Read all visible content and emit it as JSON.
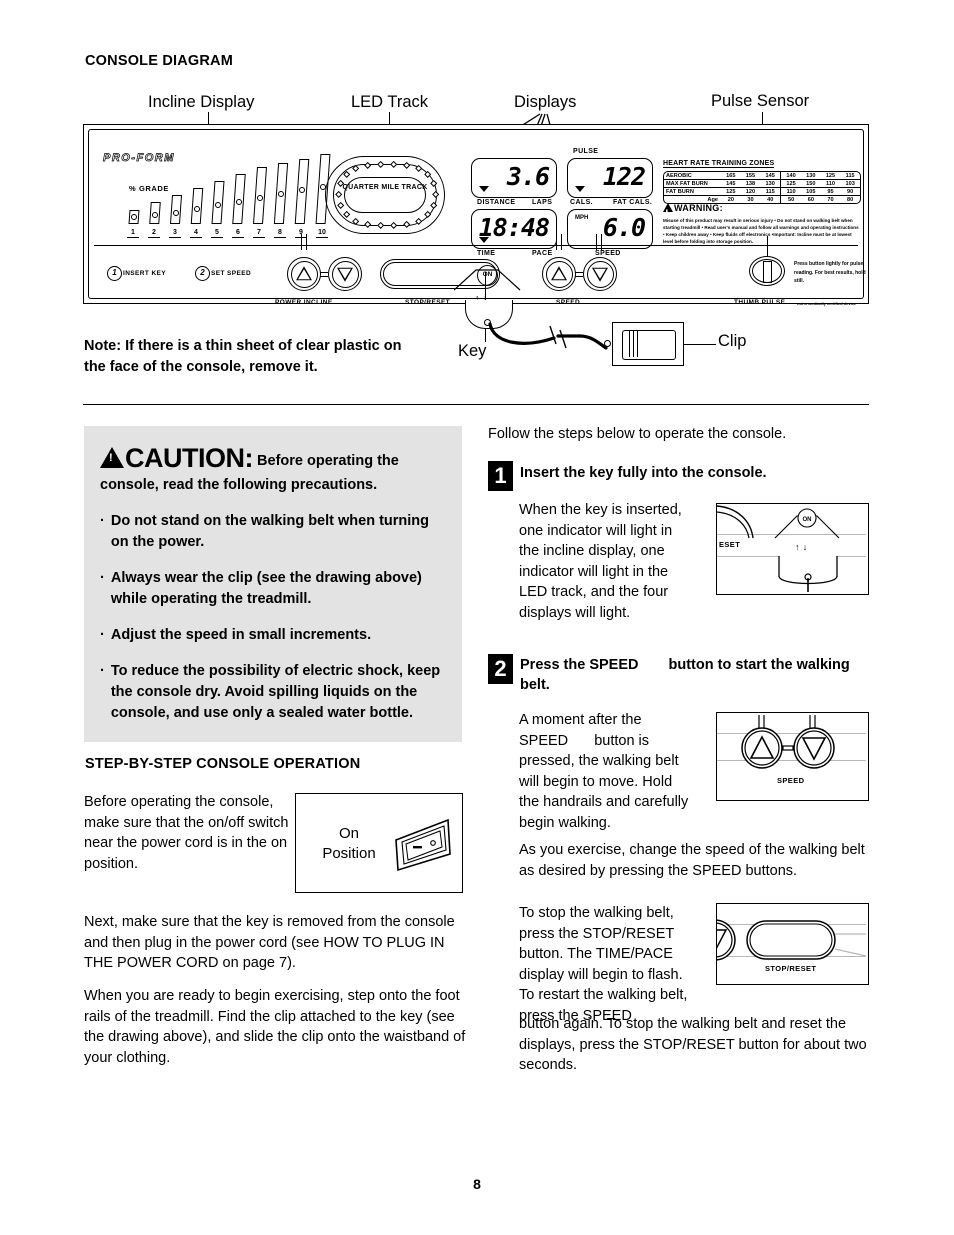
{
  "page": {
    "number": "8",
    "section_titles": {
      "console_diagram": "CONSOLE DIAGRAM",
      "step_by_step": "STEP-BY-STEP CONSOLE OPERATION"
    }
  },
  "callouts": {
    "incline_display": "Incline Display",
    "led_track": "LED Track",
    "displays": "Displays",
    "pulse_sensor": "Pulse Sensor",
    "key": "Key",
    "clip": "Clip"
  },
  "console": {
    "brand": "PRO-FORM",
    "grade_label": "% GRADE",
    "incline_numbers": [
      "1",
      "2",
      "3",
      "4",
      "5",
      "6",
      "7",
      "8",
      "9",
      "10"
    ],
    "led_track_label": "QUARTER MILE TRACK",
    "displays": [
      {
        "name": "distance-display",
        "value": "3.6",
        "left_label": "DISTANCE",
        "right_label": "LAPS"
      },
      {
        "name": "pulse-display",
        "value": "122",
        "top_label": "PULSE",
        "left_label": "CALS.",
        "right_label": "FAT CALS."
      },
      {
        "name": "time-display",
        "value": "18:48",
        "left_label": "TIME",
        "right_label": "PACE"
      },
      {
        "name": "speed-display",
        "value": "6.0",
        "mini_label": "MPH",
        "right_label": "SPEED"
      }
    ],
    "heart_rate": {
      "title": "HEART RATE TRAINING ZONES",
      "rows": [
        {
          "label": "AEROBIC",
          "values": [
            "165",
            "155",
            "145",
            "140",
            "130",
            "125",
            "115"
          ]
        },
        {
          "label": "MAX FAT BURN",
          "values": [
            "145",
            "138",
            "130",
            "125",
            "150",
            "110",
            "103"
          ]
        },
        {
          "label": "FAT BURN",
          "values": [
            "125",
            "120",
            "115",
            "110",
            "105",
            "95",
            "90"
          ]
        }
      ],
      "age_label": "Age",
      "ages": [
        "20",
        "30",
        "40",
        "50",
        "60",
        "70",
        "80"
      ]
    },
    "warning": {
      "title": "WARNING:",
      "body": "Misuse of this product may result in serious injury • Do not stand on walking belt when starting treadmill • Read user's manual and follow all warnings and operating instructions • Keep children away • Keep fluids off electronics •Important: Incline must be at lowest level before folding into storage position."
    },
    "buttons": {
      "insert_key": "INSERT KEY",
      "insert_key_num": "1",
      "set_speed": "SET SPEED",
      "set_speed_num": "2",
      "power_incline": "POWER INCLINE",
      "stop_reset": "STOP/RESET",
      "speed": "SPEED",
      "on": "ON",
      "thumb_pulse": "THUMB PULSE",
      "thumb_pulse_sub": "not a medically certified device",
      "thumb_pulse_note": "Press button lightly for pulse reading. For best results, hold still."
    }
  },
  "note": "Note: If there is a thin sheet of clear plastic on the face of the console, remove it.",
  "caution": {
    "heading_word": "CAUTION",
    "heading_colon": ":",
    "heading_rest": "Before operating the console, read the following precautions.",
    "bullet": "·",
    "items": [
      "Do not stand on the walking belt when turning on the power.",
      "Always wear the clip (see the drawing above) while operating the treadmill.",
      "Adjust the speed in small increments.",
      "To reduce the possibility of electric shock, keep the console dry. Avoid spilling liquids on the console, and use only a sealed water bottle."
    ]
  },
  "left_column": {
    "p_before": "Before operating the console, make sure that the on/off switch near the power cord is in the on position.",
    "on_position_label": "On Position",
    "p_next": "Next, make sure that the key is removed from the console and then plug in the power cord (see HOW TO PLUG IN THE POWER CORD on page 7).",
    "p_when": "When you are ready to begin exercising, step onto the foot rails of the treadmill. Find the clip attached to the key (see the drawing above), and slide the clip onto the waistband of your clothing."
  },
  "right_column": {
    "p_follow": "Follow the steps below to operate the console.",
    "step1": {
      "number": "1",
      "heading": "Insert the key fully into the console.",
      "body": "When the key is inserted, one indicator will light in the incline display, one indicator will light in the LED track, and the four displays will light.",
      "figure_labels": {
        "on": "ON",
        "reset": "ESET"
      }
    },
    "step2": {
      "number": "2",
      "heading": "Press the SPEED ▲ button to start the walking belt.",
      "heading_part1": "Press the SPEED",
      "heading_part2": "button to start the walking belt.",
      "body": "A moment after the SPEED ▲ button is pressed, the walking belt will begin to move. Hold the handrails and carefully begin walking.",
      "body_part1": "A moment after the SPEED",
      "body_part2": "button is pressed, the walking belt will begin to move. Hold the handrails and carefully begin walking.",
      "figure_caption": "SPEED"
    },
    "p_asyou": "As you exercise, change the speed of the walking belt as desired by pressing the SPEED buttons.",
    "p_tostop": "To stop the walking belt, press the STOP/RESET button. The TIME/PACE display will begin to flash. To restart the walking belt, press the SPEED",
    "p_tostop2": "button again. To stop the walking belt and reset the displays, press the STOP/RESET button for about two seconds.",
    "fig3_caption": "STOP/RESET"
  }
}
